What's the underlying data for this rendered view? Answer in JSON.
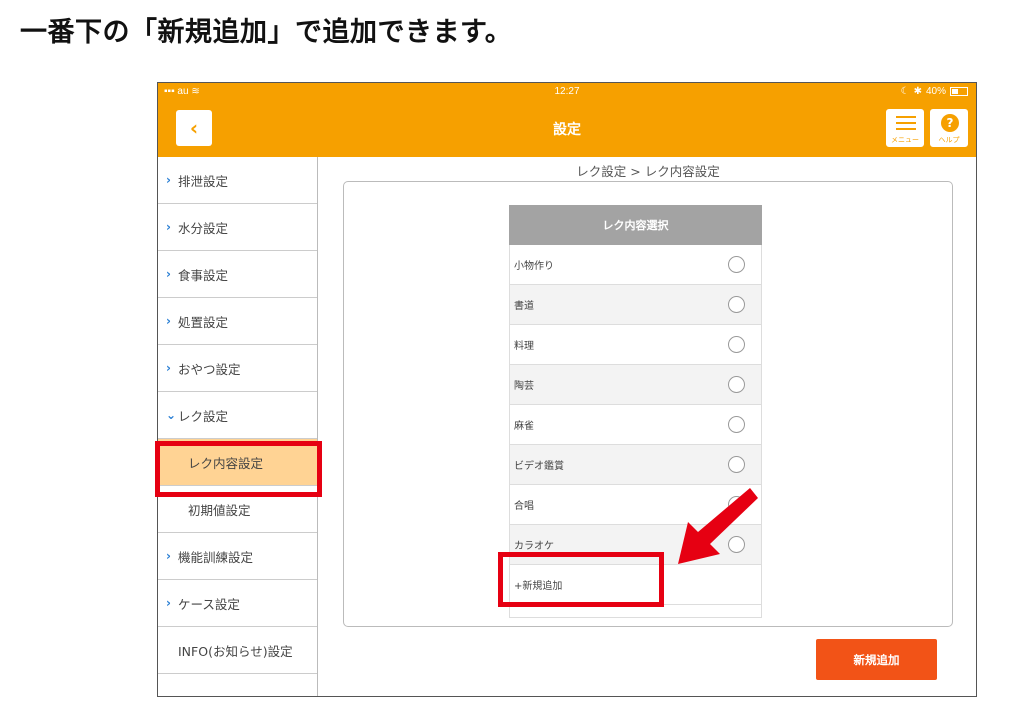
{
  "caption": "一番下の「新規追加」で追加できます。",
  "statusbar": {
    "carrier": "au",
    "time": "12:27",
    "battery": "40%"
  },
  "navbar": {
    "title": "設定",
    "menu_label": "メニュー",
    "help_label": "ヘルプ",
    "help_symbol": "?"
  },
  "sidebar": {
    "items": [
      {
        "label": "排泄設定"
      },
      {
        "label": "水分設定"
      },
      {
        "label": "食事設定"
      },
      {
        "label": "処置設定"
      },
      {
        "label": "おやつ設定"
      },
      {
        "label": "レク設定"
      },
      {
        "label": "レク内容設定"
      },
      {
        "label": "初期値設定"
      },
      {
        "label": "機能訓練設定"
      },
      {
        "label": "ケース設定"
      },
      {
        "label": "INFO(お知らせ)設定"
      }
    ]
  },
  "content": {
    "breadcrumb": "レク設定 > レク内容設定",
    "list_header": "レク内容選択",
    "rows": [
      "小物作り",
      "書道",
      "料理",
      "陶芸",
      "麻雀",
      "ビデオ鑑賞",
      "合唱",
      "カラオケ"
    ],
    "add_row": "+新規追加",
    "add_button": "新規追加"
  },
  "colors": {
    "accent": "#f6a000",
    "button": "#f25317",
    "highlight": "#e60012",
    "active": "#ffd394"
  }
}
